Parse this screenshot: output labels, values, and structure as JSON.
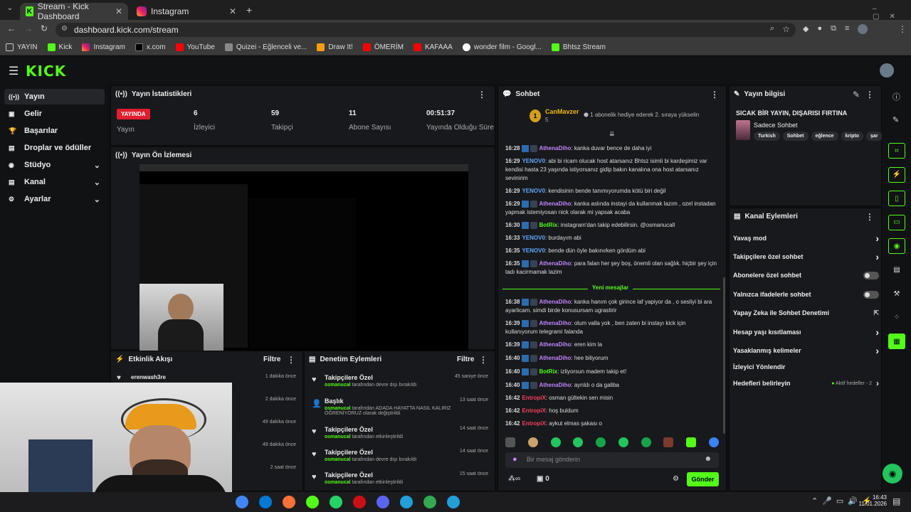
{
  "browser": {
    "tabs": [
      {
        "title": "Stream - Kick Dashboard",
        "active": true
      },
      {
        "title": "Instagram",
        "active": false
      }
    ],
    "url": "dashboard.kick.com/stream",
    "bookmarks": [
      "YAYIN",
      "Kick",
      "Instagram",
      "x.com",
      "YouTube",
      "Quizei - Eğlenceli ve...",
      "Draw It!",
      "ÖMERİM",
      "KAFAAA",
      "wonder film - Googl...",
      "Bhtsz Stream"
    ]
  },
  "kick": {
    "logo": "KICK",
    "sidebar": [
      {
        "label": "Yayın",
        "icon": "broadcast-icon",
        "active": true,
        "chevron": false
      },
      {
        "label": "Gelir",
        "icon": "money-icon",
        "active": false,
        "chevron": false
      },
      {
        "label": "Başarılar",
        "icon": "trophy-icon",
        "active": false,
        "chevron": false
      },
      {
        "label": "Droplar ve ödüller",
        "icon": "gift-icon",
        "active": false,
        "chevron": false
      },
      {
        "label": "Stüdyo",
        "icon": "studio-icon",
        "active": false,
        "chevron": true
      },
      {
        "label": "Kanal",
        "icon": "channel-icon",
        "active": false,
        "chevron": true
      },
      {
        "label": "Ayarlar",
        "icon": "gear-icon",
        "active": false,
        "chevron": true
      }
    ]
  },
  "stats": {
    "title": "Yayın İstatistikleri",
    "live_badge": "YAYINDA",
    "live_label": "Yayın",
    "items": [
      {
        "value": "6",
        "label": "İzleyici"
      },
      {
        "value": "59",
        "label": "Takipçi"
      },
      {
        "value": "11",
        "label": "Abone Sayısı"
      },
      {
        "value": "00:51:37",
        "label": "Yayında Olduğu Süre"
      }
    ]
  },
  "preview": {
    "title": "Yayın Ön İzlemesi"
  },
  "events": {
    "title": "Etkinlik Akışı",
    "filter": "Filtre",
    "rows": [
      {
        "user": "erenwash3re",
        "time": "1 dakika önce"
      },
      {
        "user": "",
        "time": "2 dakika önce"
      },
      {
        "user": "",
        "time": "49 dakika önce"
      },
      {
        "user": "",
        "time": "49 dakika önce"
      },
      {
        "user": "",
        "time": "2 saat önce"
      }
    ]
  },
  "moderation": {
    "title": "Denetim Eylemleri",
    "filter": "Filtre",
    "rows": [
      {
        "title": "Takipçilere Özel",
        "user": "osmanucal",
        "desc": "tarafından devre dışı bırakıldı",
        "time": "45 saniye önce",
        "icon": "heart-icon"
      },
      {
        "title": "Başlık",
        "user": "osmanucal",
        "desc": "tarafından ADADA HAYATTA NASIL KALIRIZ ÖĞRENİYORUZ olarak değiştirildi",
        "time": "13 saat önce",
        "icon": "user-edit-icon"
      },
      {
        "title": "Takipçilere Özel",
        "user": "osmanucal",
        "desc": "tarafından etkinleştirildi",
        "time": "14 saat önce",
        "icon": "heart-icon"
      },
      {
        "title": "Takipçilere Özel",
        "user": "osmanucal",
        "desc": "tarafından devre dışı bırakıldı",
        "time": "14 saat önce",
        "icon": "heart-icon"
      },
      {
        "title": "Takipçilere Özel",
        "user": "osmanucal",
        "desc": "tarafından etkinleştirildi",
        "time": "15 saat önce",
        "icon": "heart-icon"
      }
    ]
  },
  "chat": {
    "title": "Sohbet",
    "top_gifter": "CanMavzer",
    "top_gifter_count": "5",
    "gift_note": "1 abonelik hediye ederek 2. sıraya yükselin",
    "new_messages": "Yeni mesajlar",
    "messages_before": [
      {
        "time": "16:28",
        "user": "AthenaDiho",
        "cls": "u1",
        "text": "kanka duvar bence de daha iyi"
      },
      {
        "time": "16:29",
        "user": "YENOV0",
        "cls": "u2",
        "text": "abi bi ricam olucak host atarsanız Bhtsz isimli bi kardeşimiz var kendisi hasta 23 yaşında istiyorsanız gidip bakın kanalına ona host atarsanız sevinirim"
      },
      {
        "time": "16:29",
        "user": "YENOV0",
        "cls": "u2",
        "text": "kendisinin bende tanımıyorumda kötü biri değil"
      },
      {
        "time": "16:29",
        "user": "AthenaDiho",
        "cls": "u1",
        "text": "kanka aslında instayi da kullanmak lazım , ozel instadan yapmak istemiyosan nick olarak mi yapsak acaba"
      },
      {
        "time": "16:30",
        "user": "BotRix",
        "cls": "u3",
        "text": "instagram'dan takip edebilirsin. @osmanucall"
      },
      {
        "time": "16:33",
        "user": "YENOV0",
        "cls": "u2",
        "text": "burdayım abi"
      },
      {
        "time": "16:35",
        "user": "YENOV0",
        "cls": "u2",
        "text": "bende dün öyle bakınırken gördüm abi"
      },
      {
        "time": "16:35",
        "user": "AthenaDiho",
        "cls": "u1",
        "text": "para falan her şey boş, önemli olan sağlık. hiçbir şey için tadı kacirmamak lazim"
      }
    ],
    "messages_after": [
      {
        "time": "16:38",
        "user": "AthenaDiho",
        "cls": "u1",
        "text": "kanka hanım çok girince laf yapiyor da , o sesliyi bi ara ayarlicam. simdi birde konusursam ugrastirir"
      },
      {
        "time": "16:39",
        "user": "AthenaDiho",
        "cls": "u1",
        "text": "olum valla yok , ben zaten bi instayı kick için kullanıyorum telegrami falanda"
      },
      {
        "time": "16:39",
        "user": "AthenaDiho",
        "cls": "u1",
        "text": "eren kim la"
      },
      {
        "time": "16:40",
        "user": "AthenaDiho",
        "cls": "u1",
        "text": "hee biliyorum"
      },
      {
        "time": "16:40",
        "user": "BotRix",
        "cls": "u3",
        "text": "izliyorsun madem takip et!"
      },
      {
        "time": "16:40",
        "user": "AthenaDiho",
        "cls": "u1",
        "text": "ayrıldı o da galiba"
      },
      {
        "time": "16:42",
        "user": "EntropiX",
        "cls": "u4",
        "text": "osman gültekin sen misin"
      },
      {
        "time": "16:42",
        "user": "EntropiX",
        "cls": "u4",
        "text": "hoş buldum"
      },
      {
        "time": "16:42",
        "user": "EntropiX",
        "cls": "u4",
        "text": "aykut elmas şakası o"
      }
    ],
    "input_placeholder": "Bir mesaj gönderin",
    "points": "0",
    "send": "Gönder"
  },
  "stream_info": {
    "title": "Yayın bilgisi",
    "stream_title": "SICAK BİR YAYIN, DIŞARISI FIRTINA",
    "category": "Sadece Sohbet",
    "tags": [
      "Turkish",
      "Sohbet",
      "eğlence",
      "kripto",
      "şar"
    ]
  },
  "channel_actions": {
    "title": "Kanal Eylemleri",
    "rows": [
      {
        "label": "Yavaş mod",
        "control": "chevron"
      },
      {
        "label": "Takipçilere özel sohbet",
        "control": "chevron"
      },
      {
        "label": "Abonelere özel sohbet",
        "control": "toggle"
      },
      {
        "label": "Yalnızca ifadelerle sohbet",
        "control": "toggle"
      },
      {
        "label": "Yapay Zeka ile Sohbet Denetimi",
        "control": "external"
      },
      {
        "label": "Hesap yaşı kısıtlaması",
        "control": "chevron"
      },
      {
        "label": "Yasaklanmış kelimeler",
        "control": "chevron"
      },
      {
        "label": "İzleyici Yönlendir",
        "control": "none"
      },
      {
        "label": "Hedefleri belirleyin",
        "control": "chevron"
      }
    ],
    "active_goals": "Aktif hedefler - 2"
  },
  "taskbar": {
    "time": "16:43",
    "date": "11.01.2026"
  },
  "colors": {
    "accent": "#53fc18",
    "live": "#e11d2e",
    "panel": "#18191c"
  }
}
